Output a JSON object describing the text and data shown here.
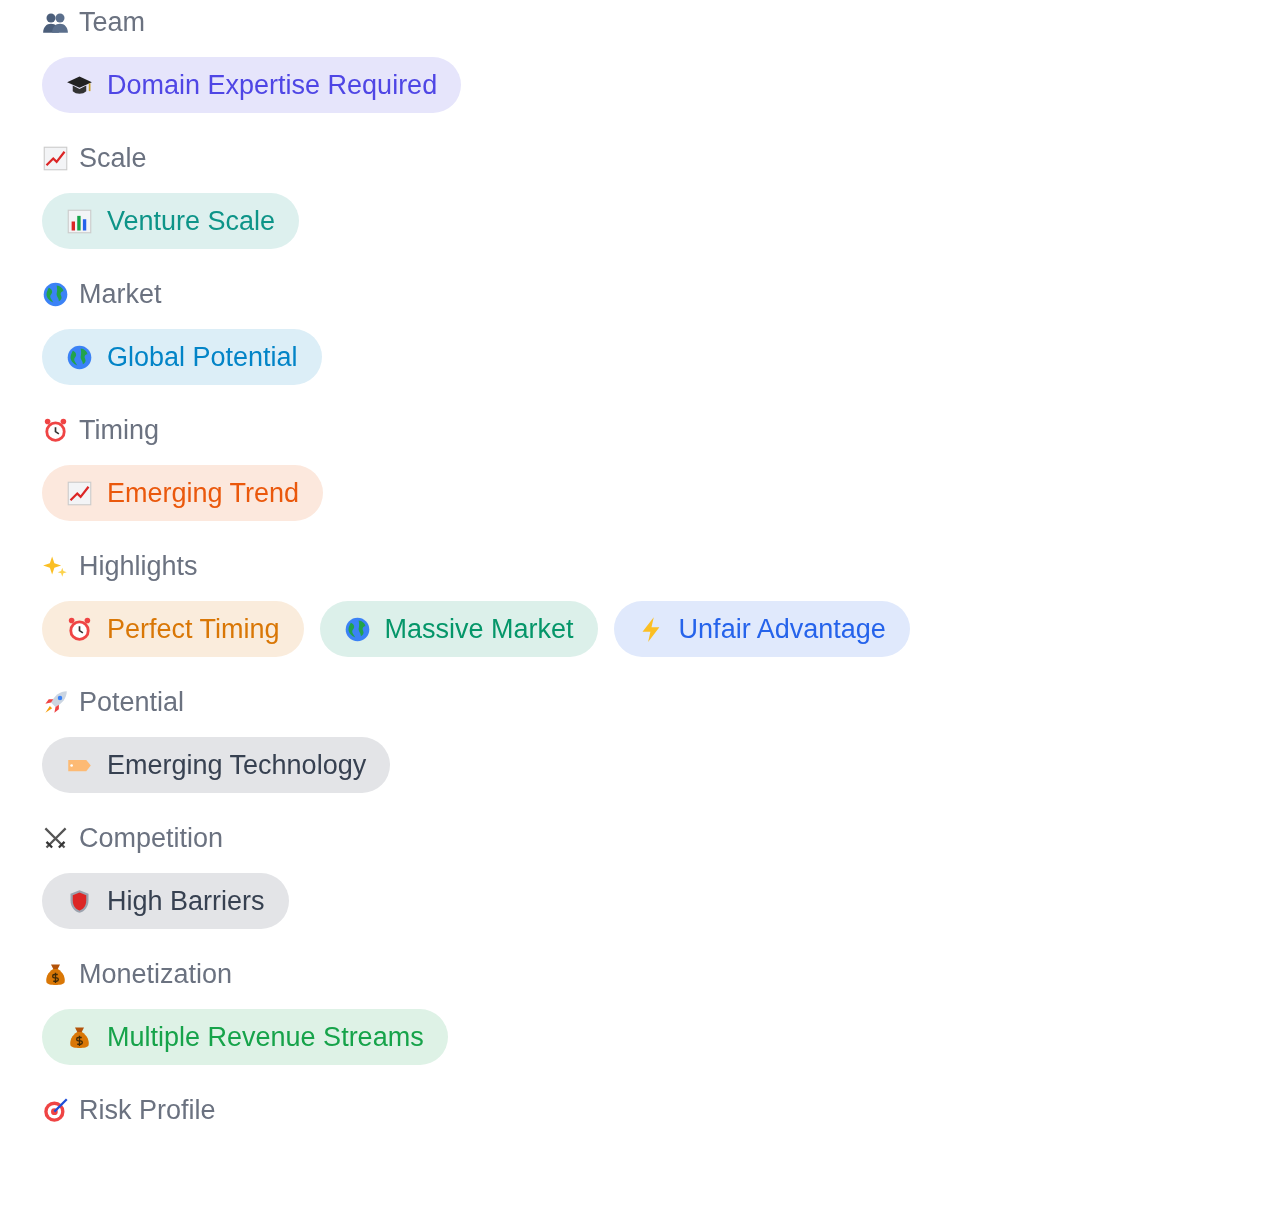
{
  "sections": [
    {
      "title": "Team",
      "kind": "people",
      "tags": [
        {
          "label": "Domain Expertise Required",
          "kind": "cap",
          "color": "#4f46e5"
        }
      ]
    },
    {
      "title": "Scale",
      "kind": "trend",
      "tags": [
        {
          "label": "Venture Scale",
          "kind": "bars",
          "color": "#0d9488"
        }
      ]
    },
    {
      "title": "Market",
      "kind": "globe",
      "tags": [
        {
          "label": "Global Potential",
          "kind": "globe",
          "color": "#0284c7"
        }
      ]
    },
    {
      "title": "Timing",
      "kind": "clock",
      "tags": [
        {
          "label": "Emerging Trend",
          "kind": "trend",
          "color": "#ea580c"
        }
      ]
    },
    {
      "title": "Highlights",
      "kind": "sparkles",
      "tags": [
        {
          "label": "Perfect Timing",
          "kind": "clock",
          "color": "#d97706"
        },
        {
          "label": "Massive Market",
          "kind": "globe",
          "color": "#059669"
        },
        {
          "label": "Unfair Advantage",
          "kind": "bolt",
          "color": "#2563eb"
        }
      ]
    },
    {
      "title": "Potential",
      "kind": "rocket",
      "tags": [
        {
          "label": "Emerging Technology",
          "kind": "label",
          "color": "#374151"
        }
      ]
    },
    {
      "title": "Competition",
      "kind": "swords",
      "tags": [
        {
          "label": "High Barriers",
          "kind": "shield",
          "color": "#374151"
        }
      ]
    },
    {
      "title": "Monetization",
      "kind": "moneybag",
      "tags": [
        {
          "label": "Multiple Revenue Streams",
          "kind": "moneybag",
          "color": "#16a34a"
        }
      ]
    },
    {
      "title": "Risk Profile",
      "kind": "target"
    }
  ]
}
